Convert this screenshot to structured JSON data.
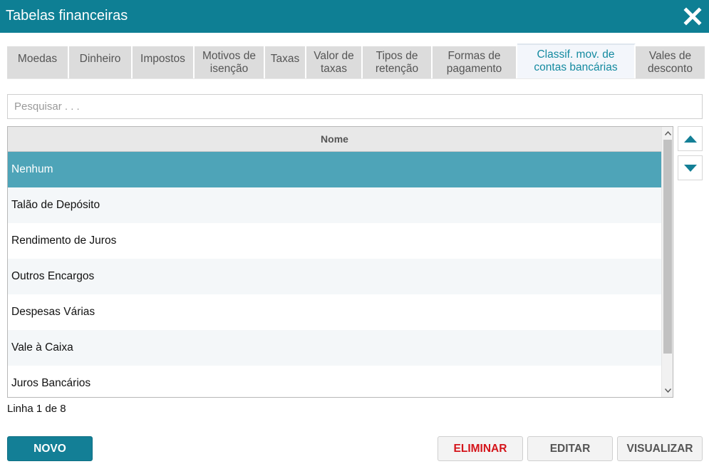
{
  "window": {
    "title": "Tabelas financeiras",
    "close_icon": "close-icon"
  },
  "tabs": [
    {
      "label": "Moedas",
      "active": false
    },
    {
      "label": "Dinheiro",
      "active": false
    },
    {
      "label": "Impostos",
      "active": false
    },
    {
      "label": "Motivos de isenção",
      "active": false
    },
    {
      "label": "Taxas",
      "active": false
    },
    {
      "label": "Valor de taxas",
      "active": false
    },
    {
      "label": "Tipos de retenção",
      "active": false
    },
    {
      "label": "Formas de pagamento",
      "active": false
    },
    {
      "label": "Classif. mov. de contas bancárias",
      "active": true
    },
    {
      "label": "Vales de desconto",
      "active": false
    }
  ],
  "search": {
    "placeholder": "Pesquisar . . .",
    "value": ""
  },
  "grid": {
    "column_header": "Nome",
    "rows": [
      {
        "name": "Nenhum",
        "selected": true
      },
      {
        "name": "Talão de Depósito",
        "selected": false
      },
      {
        "name": "Rendimento de Juros",
        "selected": false
      },
      {
        "name": "Outros Encargos",
        "selected": false
      },
      {
        "name": "Despesas Várias",
        "selected": false
      },
      {
        "name": "Vale à Caixa",
        "selected": false
      },
      {
        "name": "Juros Bancários",
        "selected": false
      }
    ]
  },
  "status": {
    "text": "Linha 1 de 8"
  },
  "side_buttons": {
    "move_up_icon": "triangle-up-icon",
    "move_down_icon": "triangle-down-icon"
  },
  "actions": {
    "new_label": "NOVO",
    "delete_label": "ELIMINAR",
    "edit_label": "EDITAR",
    "view_label": "VISUALIZAR"
  },
  "colors": {
    "titlebar": "#0e7f94",
    "selected_row": "#4ea4b8",
    "primary_button": "#137f96",
    "delete_text": "#d4141a",
    "active_tab_text": "#148aa0"
  }
}
